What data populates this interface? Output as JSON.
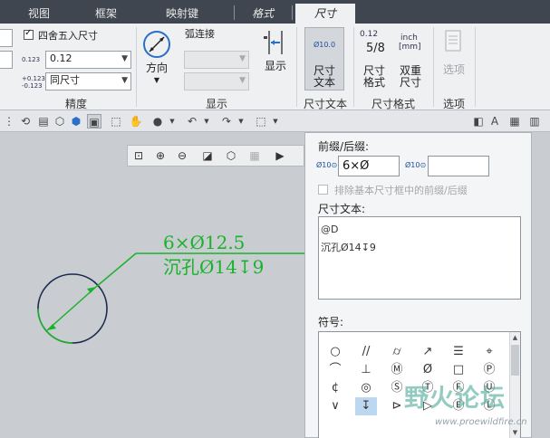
{
  "tabs": [
    {
      "label": "视图"
    },
    {
      "label": "框架"
    },
    {
      "label": "映射键"
    },
    {
      "label": "格式"
    },
    {
      "label": "尺寸"
    }
  ],
  "ribbon": {
    "precision": {
      "round_label": "四舍五入尺寸",
      "round_checked": true,
      "decimal_icon": "0.123",
      "decimal_value": "0.12",
      "tol_icon_top": "+0.123",
      "tol_icon_bottom": "-0.123",
      "tol_value": "同尺寸",
      "group_label": "精度"
    },
    "display": {
      "arc_label": "弧连接",
      "direction_label": "方向",
      "show_label": "显示",
      "group_label": "显示"
    },
    "dim_text": {
      "icon_text": "Ø10.0",
      "button_line1": "尺寸",
      "button_line2": "文本",
      "group_label": "尺寸文本"
    },
    "dim_format": {
      "frac_icon": "0.12",
      "frac_value": "5/8",
      "unit_icon_line1": "inch",
      "unit_icon_line2": "[mm]",
      "format_line1": "尺寸",
      "format_line2": "格式",
      "dual_line1": "双重",
      "dual_line2": "尺寸",
      "group_label": "尺寸格式"
    },
    "options": {
      "button_label": "选项",
      "group_label": "选项"
    }
  },
  "drawing": {
    "line1": "6×Ø12.5",
    "line2": "沉孔Ø14↧9",
    "leader_color": "#19b32a",
    "circle_color": "#1a2a4a"
  },
  "dialog": {
    "prefix_label": "前缀/后缀:",
    "prefix_icon": "Ø10⊙",
    "suffix_icon": "Ø10⊙",
    "prefix_value": "6×Ø",
    "suffix_value": "",
    "exclude_label": "排除基本尺寸框中的前缀/后缀",
    "dim_text_label": "尺寸文本:",
    "text_line1": "@D",
    "text_line2": "沉孔Ø14↧9",
    "symbols_label": "符号:",
    "symbols": [
      [
        "○",
        "//",
        "⌭",
        "↗",
        "☰",
        "⌖"
      ],
      [
        "⌒",
        "⊥",
        "Ⓜ",
        "Ø",
        "□",
        "Ⓟ"
      ],
      [
        "¢",
        "◎",
        "Ⓢ",
        "Ⓣ",
        "Ⓕ",
        "Ⓤ"
      ],
      [
        "∨",
        "↧",
        "⊳",
        "▷",
        "Ⓔ",
        "Ⓛ"
      ]
    ]
  },
  "watermark": {
    "text": "野火论坛",
    "url": "www.proewildfire.cn"
  },
  "colors": {
    "tabbar": "#3f4650",
    "ribbon": "#eef0f2",
    "canvas": "#c9ccd1",
    "accent_blue": "#2a6fc9"
  }
}
